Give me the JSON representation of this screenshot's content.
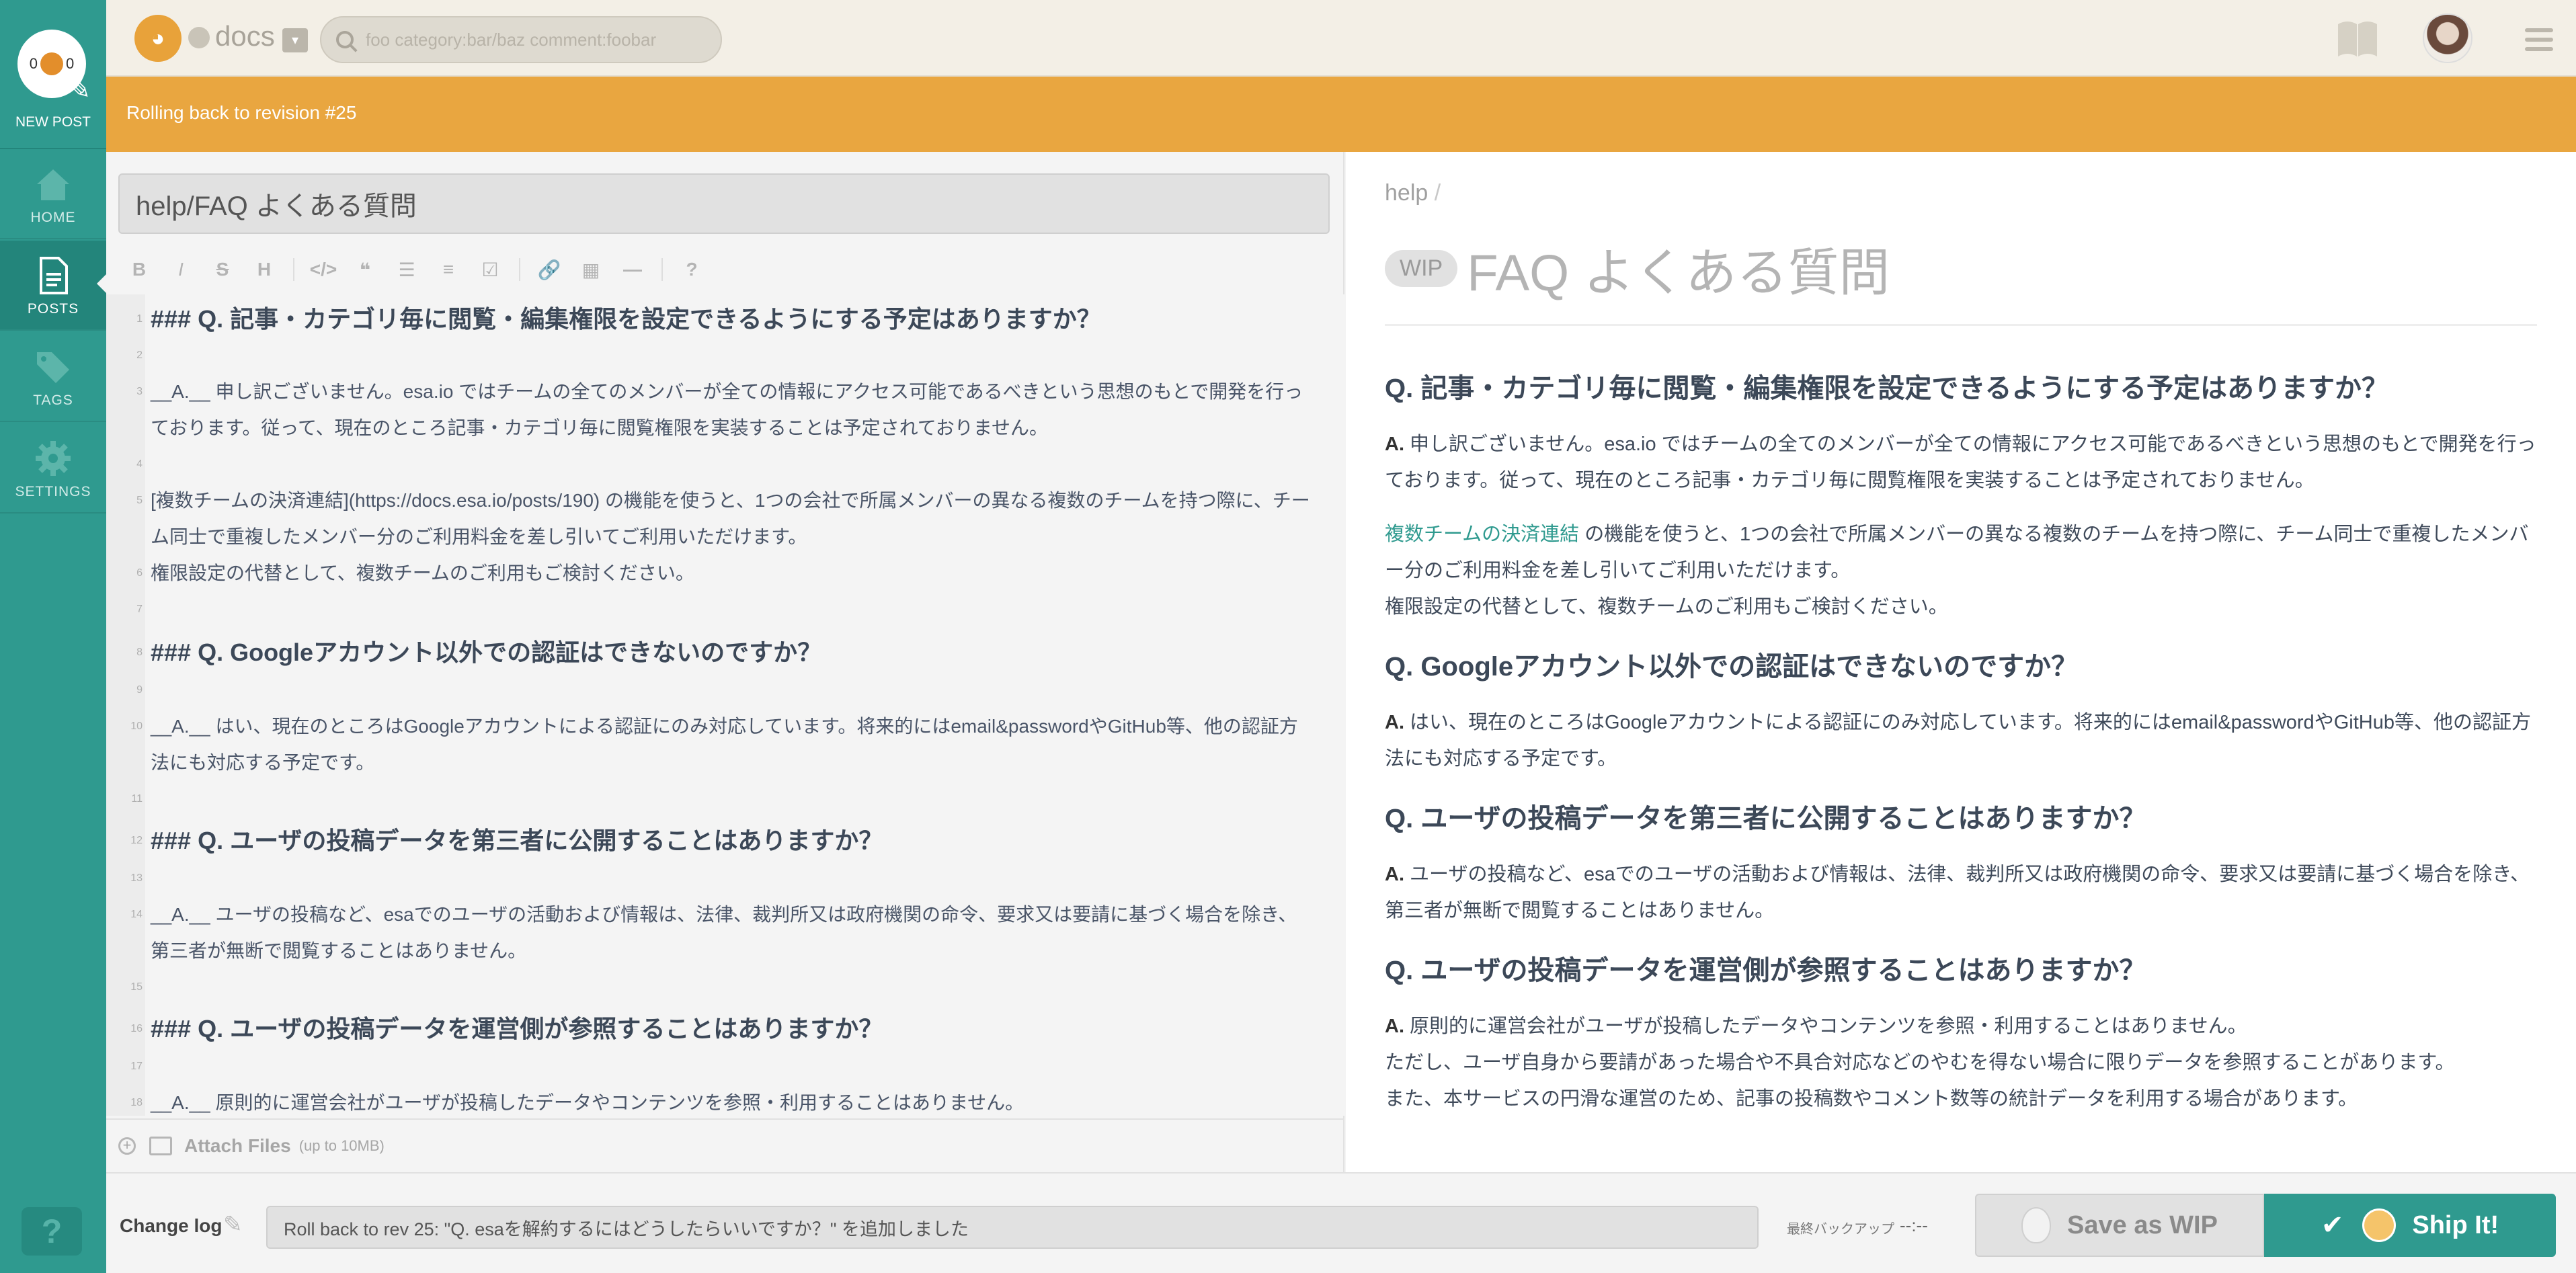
{
  "sidebar": {
    "new_post": {
      "label": "NEW POST",
      "count_left": "0",
      "count_right": "0"
    },
    "items": [
      {
        "label": "HOME",
        "icon": "home-icon"
      },
      {
        "label": "POSTS",
        "icon": "posts-icon"
      },
      {
        "label": "TAGS",
        "icon": "tags-icon"
      },
      {
        "label": "SETTINGS",
        "icon": "settings-icon"
      }
    ],
    "help": "?"
  },
  "header": {
    "team_name": "docs",
    "search_placeholder": "foo category:bar/baz comment:foobar"
  },
  "banner": {
    "text": "Rolling back to revision #25"
  },
  "editor": {
    "title": "help/FAQ よくある質問",
    "toolbar": [
      "B",
      "I",
      "S",
      "H",
      "</>",
      "❝",
      "☰",
      "≡",
      "☑",
      "🔗",
      "▦",
      "—",
      "?"
    ],
    "lines": [
      {
        "n": "1",
        "text": "### Q. 記事・カテゴリ毎に閲覧・編集権限を設定できるようにする予定はありますか？",
        "heading": true
      },
      {
        "n": "2",
        "text": ""
      },
      {
        "n": "3",
        "text": "__A.__ 申し訳ございません。esa.io ではチームの全てのメンバーが全ての情報にアクセス可能であるべきという思想のもとで開発を行っております。従って、現在のところ記事・カテゴリ毎に閲覧権限を実装することは予定されておりません。"
      },
      {
        "n": "4",
        "text": ""
      },
      {
        "n": "5",
        "text": "[複数チームの決済連結](https://docs.esa.io/posts/190) の機能を使うと、1つの会社で所属メンバーの異なる複数のチームを持つ際に、チーム同士で重複したメンバー分のご利用料金を差し引いてご利用いただけます。"
      },
      {
        "n": "6",
        "text": "権限設定の代替として、複数チームのご利用もご検討ください。"
      },
      {
        "n": "7",
        "text": ""
      },
      {
        "n": "8",
        "text": "### Q. Googleアカウント以外での認証はできないのですか？",
        "heading": true
      },
      {
        "n": "9",
        "text": ""
      },
      {
        "n": "10",
        "text": "__A.__ はい、現在のところはGoogleアカウントによる認証にのみ対応しています。将来的にはemail&passwordやGitHub等、他の認証方法にも対応する予定です。"
      },
      {
        "n": "11",
        "text": ""
      },
      {
        "n": "12",
        "text": "### Q. ユーザの投稿データを第三者に公開することはありますか？",
        "heading": true
      },
      {
        "n": "13",
        "text": ""
      },
      {
        "n": "14",
        "text": "__A.__ ユーザの投稿など、esaでのユーザの活動および情報は、法律、裁判所又は政府機関の命令、要求又は要請に基づく場合を除き、第三者が無断で閲覧することはありません。"
      },
      {
        "n": "15",
        "text": ""
      },
      {
        "n": "16",
        "text": "### Q. ユーザの投稿データを運営側が参照することはありますか？",
        "heading": true
      },
      {
        "n": "17",
        "text": ""
      },
      {
        "n": "18",
        "text": "__A.__ 原則的に運営会社がユーザが投稿したデータやコンテンツを参照・利用することはありません。"
      }
    ],
    "attach": {
      "label": "Attach Files",
      "limit": "(up to 10MB)"
    }
  },
  "preview": {
    "category": "help",
    "category_sep": "/",
    "wip_badge": "WIP",
    "title": "FAQ よくある質問",
    "sections": [
      {
        "q": "Q. 記事・カテゴリ毎に閲覧・編集権限を設定できるようにする予定はありますか？",
        "a_prefix": "A.",
        "a": " 申し訳ございません。esa.io ではチームの全てのメンバーが全ての情報にアクセス可能であるべきという思想のもとで開発を行っております。従って、現在のところ記事・カテゴリ毎に閲覧権限を実装することは予定されておりません。",
        "extra_link": "複数チームの決済連結",
        "extra_text": " の機能を使うと、1つの会社で所属メンバーの異なる複数のチームを持つ際に、チーム同士で重複したメンバー分のご利用料金を差し引いてご利用いただけます。",
        "extra_text2": "権限設定の代替として、複数チームのご利用もご検討ください。"
      },
      {
        "q": "Q. Googleアカウント以外での認証はできないのですか？",
        "a_prefix": "A.",
        "a": " はい、現在のところはGoogleアカウントによる認証にのみ対応しています。将来的にはemail&passwordやGitHub等、他の認証方法にも対応する予定です。"
      },
      {
        "q": "Q. ユーザの投稿データを第三者に公開することはありますか？",
        "a_prefix": "A.",
        "a": " ユーザの投稿など、esaでのユーザの活動および情報は、法律、裁判所又は政府機関の命令、要求又は要請に基づく場合を除き、第三者が無断で閲覧することはありません。"
      },
      {
        "q": "Q. ユーザの投稿データを運営側が参照することはありますか？",
        "a_prefix": "A.",
        "a": " 原則的に運営会社がユーザが投稿したデータやコンテンツを参照・利用することはありません。",
        "a2": "ただし、ユーザ自身から要請があった場合や不具合対応などのやむを得ない場合に限りデータを参照することがあります。",
        "a3": "また、本サービスの円滑な運営のため、記事の投稿数やコメント数等の統計データを利用する場合があります。"
      }
    ]
  },
  "bottom": {
    "changelog_label": "Change log",
    "changelog_value": "Roll back to rev 25: \"Q. esaを解約するにはどうしたらいいですか？\" を追加しました",
    "backup_label": "最終バックアップ",
    "backup_time": "--:--",
    "save_wip": "Save as WIP",
    "ship_it": "Ship It!"
  },
  "colors": {
    "accent": "#2f9a8f",
    "banner": "#e9a640",
    "header_bg": "#f3efe6"
  }
}
